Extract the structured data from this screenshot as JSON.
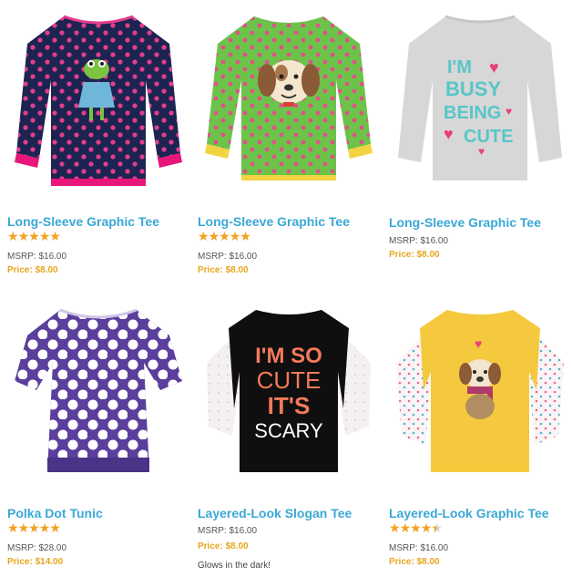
{
  "products": [
    {
      "title": "Long-Sleeve Graphic Tee",
      "rating": 5,
      "msrp": "MSRP: $16.00",
      "price": "Price: $8.00",
      "image": "navy-polka-dot-frog-tee"
    },
    {
      "title": "Long-Sleeve Graphic Tee",
      "rating": 5,
      "msrp": "MSRP: $16.00",
      "price": "Price: $8.00",
      "image": "green-polka-dot-puppy-tee"
    },
    {
      "title": "Long-Sleeve Graphic Tee",
      "msrp": "MSRP: $16.00",
      "price": "Price: $8.00",
      "image": "gray-busy-being-cute-tee",
      "graphic_text": [
        "I'M",
        "BUSY",
        "BEING",
        "CUTE"
      ]
    },
    {
      "title": "Polka Dot Tunic",
      "rating": 5,
      "msrp": "MSRP: $28.00",
      "price": "Price: $14.00",
      "image": "purple-polka-dot-tunic"
    },
    {
      "title": "Layered-Look Slogan Tee",
      "msrp": "MSRP: $16.00",
      "price": "Price: $8.00",
      "note": "Glows in the dark!",
      "image": "black-im-so-cute-its-scary-tee",
      "graphic_text": [
        "I'M SO",
        "CUTE",
        "IT'S",
        "SCARY"
      ]
    },
    {
      "title": "Layered-Look Graphic Tee",
      "rating": 4.5,
      "msrp": "MSRP: $16.00",
      "price": "Price: $8.00",
      "image": "yellow-puppy-scarf-tee"
    }
  ],
  "colors": {
    "title": "#3aa8d6",
    "price": "#e8a51e",
    "star": "#f3a11f"
  }
}
